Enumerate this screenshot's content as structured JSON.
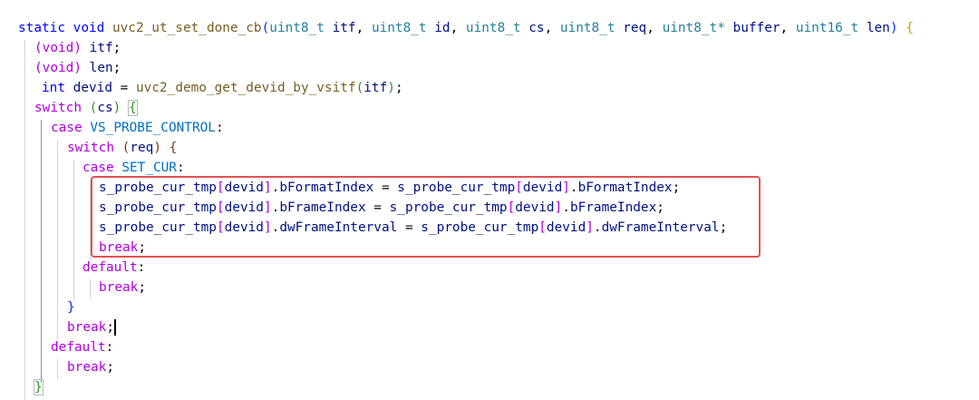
{
  "code": {
    "signature": {
      "static": "static",
      "void": "void",
      "name": "uvc2_ut_set_done_cb",
      "open": "(",
      "t1": "uint8_t",
      "p1": "itf",
      "t2": "uint8_t",
      "p2": "id",
      "t3": "uint8_t",
      "p3": "cs",
      "t4": "uint8_t",
      "p4": "req",
      "t5": "uint8_t*",
      "p5": "buffer",
      "t6": "uint16_t",
      "p6": "len",
      "close": ")",
      "brace": "{"
    },
    "l2": {
      "cast": "(void)",
      "arg": "itf"
    },
    "l3": {
      "cast": "(void)",
      "arg": "len"
    },
    "l4": {
      "type": "int",
      "var": "devid",
      "func": "uvc2_demo_get_devid_by_vsitf",
      "arg": "itf"
    },
    "l5": {
      "kw": "switch",
      "arg": "cs",
      "brace": "{"
    },
    "l6": {
      "kw": "case",
      "label": "VS_PROBE_CONTROL"
    },
    "l7": {
      "kw": "switch",
      "arg": "req",
      "brace": "{"
    },
    "l8": {
      "kw": "case",
      "label": "SET_CUR"
    },
    "l9": {
      "lhs": "s_probe_cur_tmp",
      "idx": "devid",
      "field": "bFormatIndex",
      "rhs": "s_probe_cur_tmp",
      "ridx": "devid",
      "rfield": "bFormatIndex"
    },
    "l10": {
      "lhs": "s_probe_cur_tmp",
      "idx": "devid",
      "field": "bFrameIndex",
      "rhs": "s_probe_cur_tmp",
      "ridx": "devid",
      "rfield": "bFrameIndex"
    },
    "l11": {
      "lhs": "s_probe_cur_tmp",
      "idx": "devid",
      "field": "dwFrameInterval",
      "rhs": "s_probe_cur_tmp",
      "ridx": "devid",
      "rfield": "dwFrameInterval"
    },
    "l12": {
      "kw": "break"
    },
    "l13": {
      "kw": "default"
    },
    "l14": {
      "kw": "break"
    },
    "l15": {
      "brace": "}"
    },
    "l16": {
      "kw": "break"
    },
    "l17": {
      "kw": "default"
    },
    "l18": {
      "kw": "break"
    },
    "l19": {
      "brace": "}"
    }
  },
  "colors": {
    "keyword": "#0000ff",
    "control": "#af00db",
    "type": "#267f99",
    "function": "#795e26",
    "variable": "#001080",
    "macro": "#0070c1",
    "highlight_box": "#e05252"
  }
}
